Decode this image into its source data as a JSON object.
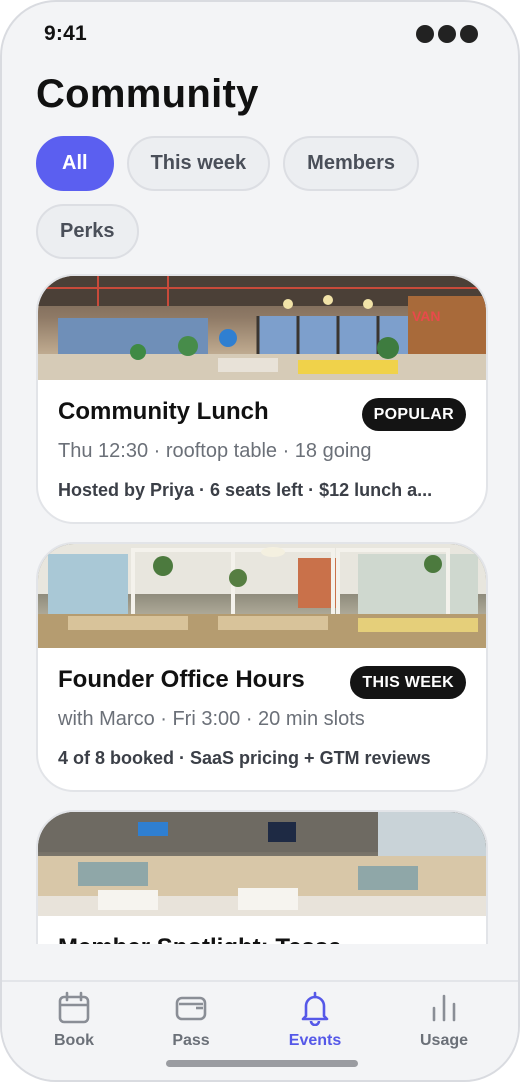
{
  "status": {
    "time": "9:41"
  },
  "page": {
    "title": "Community"
  },
  "filters": [
    {
      "label": "All",
      "active": true
    },
    {
      "label": "This week",
      "active": false
    },
    {
      "label": "Members",
      "active": false
    },
    {
      "label": "Perks",
      "active": false
    }
  ],
  "events": [
    {
      "name": "Community Lunch",
      "badge": "POPULAR",
      "subtitle": "Thu 12:30 · rooftop table · 18 going",
      "meta": "Hosted by Priya · 6 seats left · $12 lunch a..."
    },
    {
      "name": "Founder Office Hours",
      "badge": "THIS WEEK",
      "subtitle": "with Marco · Fri 3:00 · 20 min slots",
      "meta": "4 of 8 booked · SaaS pricing + GTM reviews"
    },
    {
      "name": "Member Spotlight: Tessa"
    }
  ],
  "tabs": [
    {
      "label": "Book",
      "icon": "calendar-icon",
      "active": false
    },
    {
      "label": "Pass",
      "icon": "wallet-icon",
      "active": false
    },
    {
      "label": "Events",
      "icon": "bell-icon",
      "active": true
    },
    {
      "label": "Usage",
      "icon": "bar-chart-icon",
      "active": false
    }
  ],
  "colors": {
    "accent": "#5b5ff0",
    "badge": "#141414",
    "background": "#f3f4f6"
  }
}
